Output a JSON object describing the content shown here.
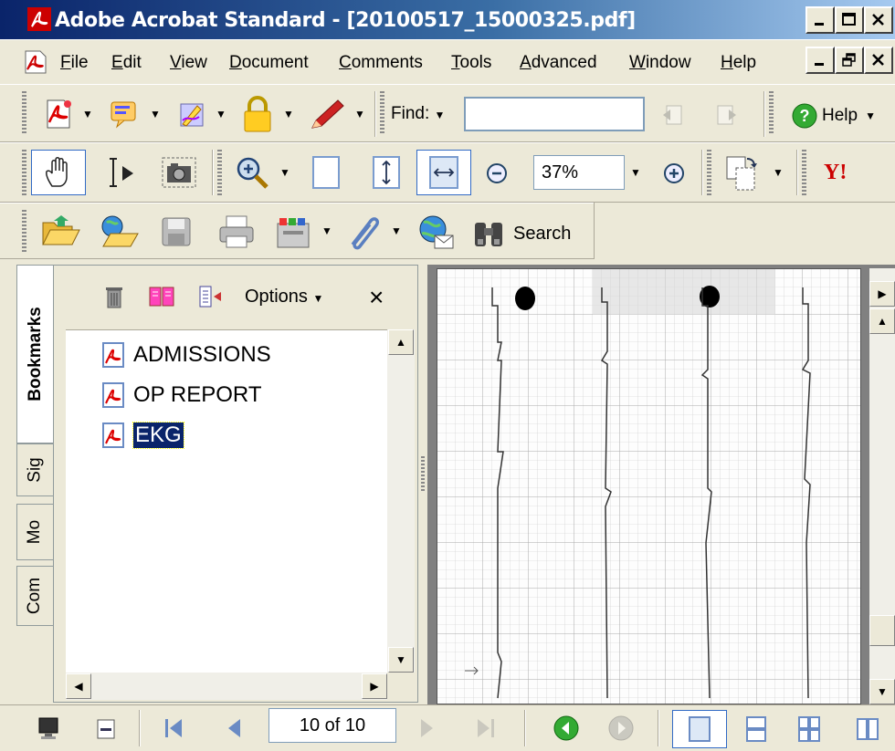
{
  "window": {
    "title": "Adobe Acrobat Standard - [20100517_15000325.pdf]"
  },
  "menu": [
    "File",
    "Edit",
    "View",
    "Document",
    "Comments",
    "Tools",
    "Advanced",
    "Window",
    "Help"
  ],
  "toolbar": {
    "find_label": "Find:",
    "find_value": "",
    "help_label": "Help",
    "zoom_value": "37%",
    "search_label": "Search"
  },
  "nav_tabs": [
    "Bookmarks",
    "Sig",
    "Mo",
    "Com"
  ],
  "bookmarks": {
    "options_label": "Options",
    "close_glyph": "×",
    "items": [
      {
        "label": "ADMISSIONS",
        "selected": false
      },
      {
        "label": "OP REPORT",
        "selected": false
      },
      {
        "label": "EKG",
        "selected": true
      }
    ]
  },
  "status": {
    "page_value": "10 of 10"
  },
  "colors": {
    "selection": "#0a246a",
    "title_start": "#0a246a",
    "title_end": "#a6caf0"
  }
}
